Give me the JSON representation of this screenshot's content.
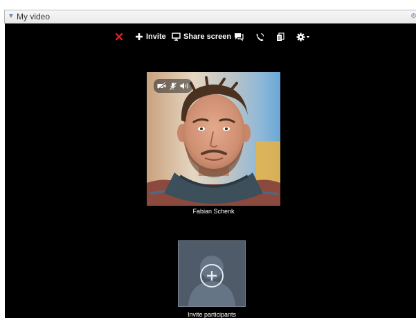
{
  "panel": {
    "title": "My video",
    "toggle_icon": "collapse-triangle-icon",
    "menu_icon": "gear-menu-icon"
  },
  "toolbar": {
    "end_call_icon": "close-x-icon",
    "invite_label": "Invite",
    "invite_icon": "plus-icon",
    "share_screen_label": "Share screen",
    "share_screen_icon": "monitor-icon",
    "chat_icon": "chat-bubble-icon",
    "phone_icon": "phone-icon",
    "notes_icon": "document-icon",
    "settings_icon": "gear-icon"
  },
  "participant": {
    "name": "Fabian Schenk",
    "controls": [
      "video-off-icon",
      "mic-off-icon",
      "speaker-icon"
    ]
  },
  "invite": {
    "label": "Invite participants",
    "icon": "add-person-icon"
  },
  "colors": {
    "video_background": "#000000",
    "end_call": "#e02020",
    "invite_tile": "#4f5b68",
    "panel_header": "#eeeeee",
    "panel_accent": "#6f8db0"
  }
}
